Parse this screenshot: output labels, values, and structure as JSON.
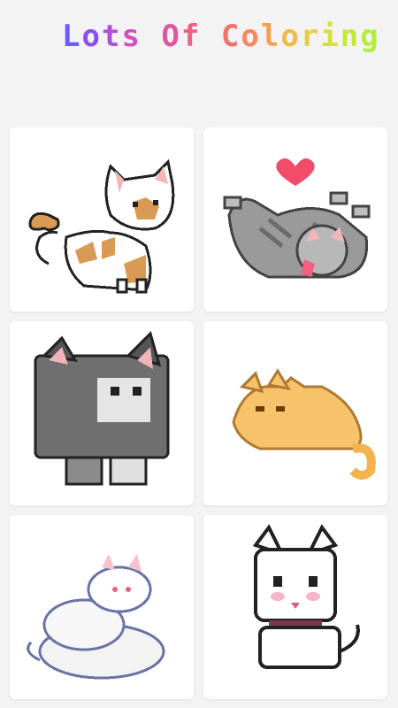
{
  "app": {
    "title": "Lots Of Coloring",
    "title_colors": [
      "#6a5cff",
      "#8a4cf3",
      "#b14ed6",
      "#d14fbf",
      "#e2569f",
      "#ee5f86",
      "#f3706d",
      "#f7875c",
      "#f79f4c",
      "#f3b848",
      "#e8ce41",
      "#d8df3c",
      "#c4e83a",
      "#b2ee38",
      "#a3f03a",
      "#9ef33c"
    ]
  },
  "gallery": {
    "items": [
      {
        "name": "cat-standing-orange-calico"
      },
      {
        "name": "cat-gray-rolling-heart"
      },
      {
        "name": "cat-gray-kitten-sitting"
      },
      {
        "name": "cat-orange-lying"
      },
      {
        "name": "cats-white-pile"
      },
      {
        "name": "cat-white-cute-collar"
      }
    ]
  }
}
